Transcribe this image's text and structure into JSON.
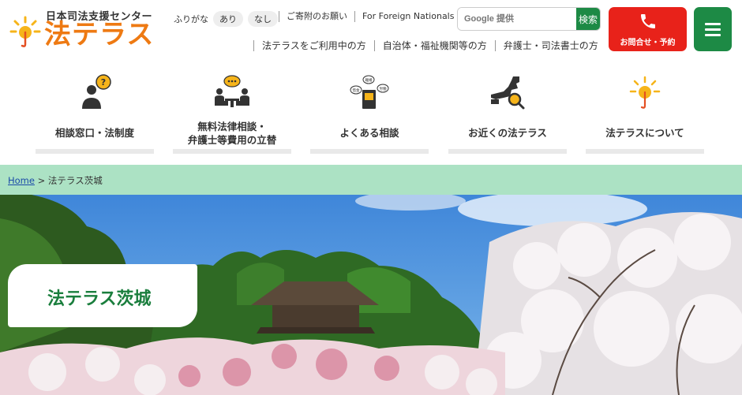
{
  "logo": {
    "sub_text": "日本司法支援センター",
    "main_text": "法テラス"
  },
  "furigana": {
    "label": "ふりがな",
    "on": "あり",
    "off": "なし"
  },
  "util_links": [
    "ご寄附のお願い",
    "For Foreign Nationals"
  ],
  "search": {
    "placeholder": "Google 提供",
    "button": "検索"
  },
  "nav_links": [
    "法テラスをご利用中の方",
    "自治体・福祉機関等の方",
    "弁護士・司法書士の方"
  ],
  "contact_button": "お問合せ・予約",
  "categories": [
    {
      "line1": "相談窓口・法制度",
      "line2": "",
      "icon": "consultation-question-icon"
    },
    {
      "line1": "無料法律相談・",
      "line2": "弁護士等費用の立替",
      "icon": "meeting-talk-icon"
    },
    {
      "line1": "よくある相談",
      "line2": "",
      "icon": "faq-book-icon"
    },
    {
      "line1": "お近くの法テラス",
      "line2": "",
      "icon": "map-search-icon"
    },
    {
      "line1": "法テラスについて",
      "line2": "",
      "icon": "houterasu-sun-icon"
    }
  ],
  "faq_bubbles": [
    "離婚",
    "借金",
    "労働"
  ],
  "breadcrumb": {
    "home": "Home",
    "separator": ">",
    "current": "法テラス茨城"
  },
  "hero": {
    "title": "法テラス茨城"
  },
  "colors": {
    "brand_orange": "#ee7a13",
    "brand_green": "#1d8a45",
    "contact_red": "#e8221a",
    "breadcrumb_bg": "#ace2c4"
  }
}
